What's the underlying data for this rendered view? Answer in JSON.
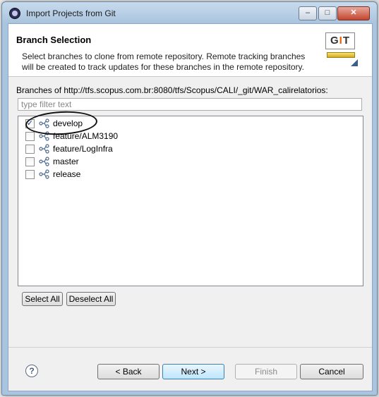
{
  "window": {
    "title": "Import Projects from Git",
    "controls": {
      "minimize": "–",
      "maximize": "□",
      "close": "✕"
    }
  },
  "header": {
    "title": "Branch Selection",
    "description": "Select branches to clone from remote repository. Remote tracking branches will be created to track updates for these branches in the remote repository.",
    "logo_text": {
      "g": "G",
      "i": "I",
      "t": "T"
    }
  },
  "branches": {
    "label": "Branches of http://tfs.scopus.com.br:8080/tfs/Scopus/CALI/_git/WAR_calirelatorios:",
    "filter_placeholder": "type filter text",
    "filter_value": "",
    "items": [
      {
        "label": "develop",
        "checked": true
      },
      {
        "label": "feature/ALM3190",
        "checked": false
      },
      {
        "label": "feature/LogInfra",
        "checked": false
      },
      {
        "label": "master",
        "checked": false
      },
      {
        "label": "release",
        "checked": false
      }
    ]
  },
  "selection_buttons": {
    "select_all": "Select All",
    "deselect_all": "Deselect All"
  },
  "footer": {
    "help": "?",
    "back": "< Back",
    "next": "Next >",
    "finish": "Finish",
    "cancel": "Cancel"
  },
  "colors": {
    "title_bar": "#a9c4de",
    "default_button_border": "#3c7fb1",
    "checkmark": "#1b3f8b",
    "git_accent": "#e26100"
  }
}
